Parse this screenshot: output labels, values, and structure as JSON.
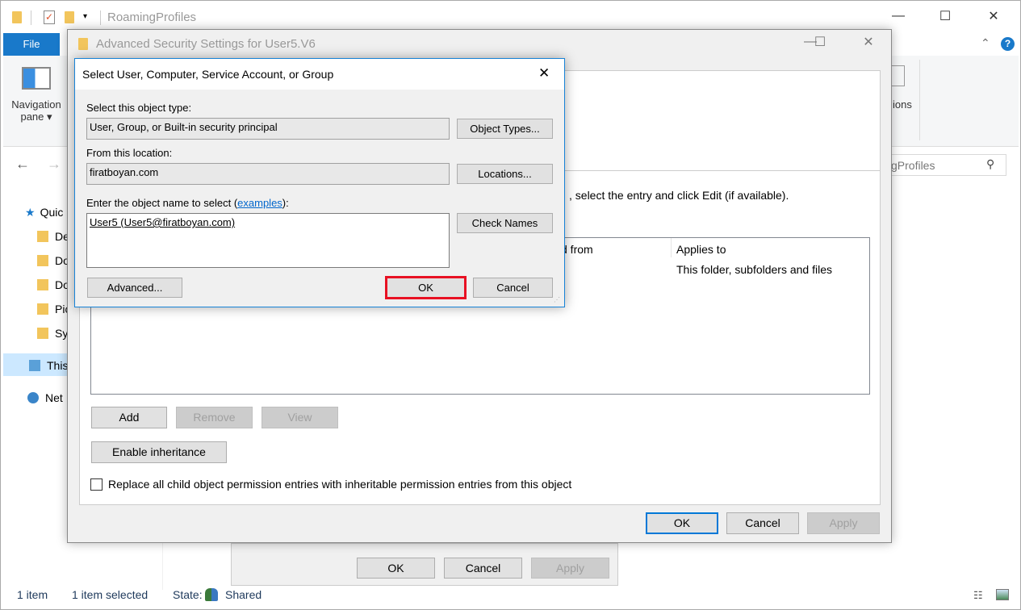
{
  "explorer": {
    "title": "RoamingProfiles",
    "file_tab": "File",
    "ribbon": {
      "navigation_pane": "Navigation",
      "navigation_pane_2": "pane",
      "options_partial": "ions"
    },
    "search_partial": "gProfiles",
    "nav_items": [
      {
        "label": "Quic",
        "icon": "star-icon"
      },
      {
        "label": "De",
        "icon": "folder-icon"
      },
      {
        "label": "Do",
        "icon": "download-icon"
      },
      {
        "label": "Do",
        "icon": "document-icon"
      },
      {
        "label": "Pic",
        "icon": "pictures-icon"
      },
      {
        "label": "Sy",
        "icon": "folder-icon"
      },
      {
        "label": "This",
        "icon": "computer-icon"
      },
      {
        "label": "Net",
        "icon": "network-icon"
      }
    ],
    "status": {
      "items": "1 item",
      "selected": "1 item selected",
      "state_label": "State:",
      "state_value": "Shared"
    },
    "back_dialog": {
      "ok": "OK",
      "cancel": "Cancel",
      "apply": "Apply"
    }
  },
  "advanced": {
    "title": "Advanced Security Settings for User5.V6",
    "instruction_partial": ", select the entry and click Edit (if available).",
    "columns": {
      "inherited_partial": "d from",
      "applies_to": "Applies to"
    },
    "row": {
      "applies_to": "This folder, subfolders and files"
    },
    "add": "Add",
    "remove": "Remove",
    "view": "View",
    "enable_inheritance": "Enable inheritance",
    "replace_checkbox": "Replace all child object permission entries with inheritable permission entries from this object",
    "ok": "OK",
    "cancel": "Cancel",
    "apply": "Apply"
  },
  "select_dialog": {
    "title": "Select User, Computer, Service Account, or Group",
    "object_type_label": "Select this object type:",
    "object_type_value": "User, Group, or Built-in security principal",
    "object_types_button": "Object Types...",
    "location_label": "From this location:",
    "location_value": "firatboyan.com",
    "locations_button": "Locations...",
    "enter_label": "Enter the object name to select (",
    "examples_link": "examples",
    "enter_label_end": "):",
    "object_name_value": "User5 (User5@firatboyan.com)",
    "check_names": "Check Names",
    "advanced": "Advanced...",
    "ok": "OK",
    "cancel": "Cancel",
    "highlight_color": "#e81123"
  }
}
